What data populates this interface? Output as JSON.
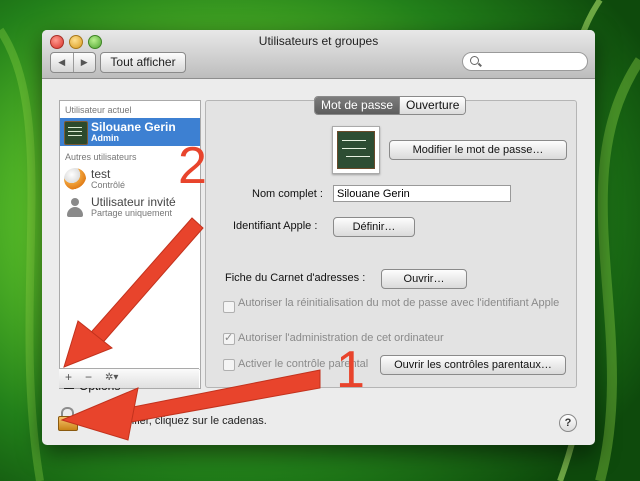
{
  "window": {
    "title": "Utilisateurs et groupes",
    "show_all": "Tout afficher",
    "nav_back": "◀",
    "nav_forward": "▶"
  },
  "sidebar": {
    "current_header": "Utilisateur actuel",
    "current_user": {
      "name": "Silouane Gerin",
      "role": "Admin"
    },
    "others_header": "Autres utilisateurs",
    "others": [
      {
        "name": "test",
        "role": "Contrôlé"
      },
      {
        "name": "Utilisateur invité",
        "role": "Partage uniquement"
      }
    ],
    "options_label": "Options",
    "add": "+",
    "remove": "−",
    "action": "✲▾"
  },
  "tabs": [
    "Mot de passe",
    "Ouverture"
  ],
  "password_pane": {
    "change_password": "Modifier le mot de passe…",
    "full_name_label": "Nom complet :",
    "full_name_value": "Silouane Gerin",
    "apple_id_label": "Identifiant Apple :",
    "apple_id_button": "Définir…",
    "address_book_label": "Fiche du Carnet d'adresses :",
    "address_book_button": "Ouvrir…",
    "options": [
      {
        "label": "Autoriser la réinitialisation du mot de passe avec l'identifiant Apple",
        "checked": false
      },
      {
        "label": "Autoriser l'administration de cet ordinateur",
        "checked": true
      },
      {
        "label": "Activer le contrôle parental",
        "checked": false
      }
    ],
    "parental_button": "Ouvrir les contrôles parentaux…"
  },
  "footer": {
    "lock_text": "Pour modifier, cliquez sur le cadenas.",
    "help": "?"
  },
  "annotations": [
    "1",
    "2"
  ],
  "colors": {
    "arrow": "#e8442c",
    "selection": "#3d80d2",
    "background": "#2f8a18"
  }
}
